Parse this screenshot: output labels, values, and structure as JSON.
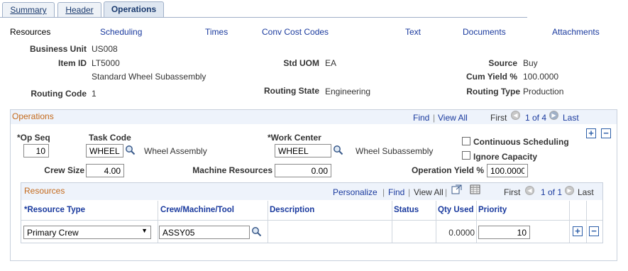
{
  "tabs": [
    {
      "label": "Summary"
    },
    {
      "label": "Header"
    },
    {
      "label": "Operations"
    }
  ],
  "links": {
    "resources": "Resources",
    "scheduling": "Scheduling",
    "times": "Times",
    "conv_cost_codes": "Conv Cost Codes",
    "text": "Text",
    "documents": "Documents",
    "attachments": "Attachments"
  },
  "header": {
    "business_unit_label": "Business Unit",
    "business_unit": "US008",
    "item_id_label": "Item ID",
    "item_id": "LT5000",
    "item_desc": "Standard Wheel Subassembly",
    "routing_code_label": "Routing Code",
    "routing_code": "1",
    "std_uom_label": "Std UOM",
    "std_uom": "EA",
    "routing_state_label": "Routing State",
    "routing_state": "Engineering",
    "source_label": "Source",
    "source": "Buy",
    "cum_yield_label": "Cum Yield %",
    "cum_yield": "100.0000",
    "routing_type_label": "Routing Type",
    "routing_type": "Production"
  },
  "operations": {
    "title": "Operations",
    "find": "Find",
    "view_all": "View All",
    "first": "First",
    "count": "1 of 4",
    "last": "Last",
    "op_seq_label": "*Op Seq",
    "op_seq": "10",
    "task_code_label": "Task Code",
    "task_code": "WHEEL",
    "task_desc": "Wheel Assembly",
    "work_center_label": "*Work Center",
    "work_center": "WHEEL",
    "work_center_desc": "Wheel Subassembly",
    "continuous_scheduling": "Continuous Scheduling",
    "ignore_capacity": "Ignore Capacity",
    "crew_size_label": "Crew Size",
    "crew_size": "4.00",
    "machine_resources_label": "Machine Resources",
    "machine_resources": "0.00",
    "operation_yield_label": "Operation Yield %",
    "operation_yield": "100.0000",
    "add": "+",
    "remove": "−"
  },
  "resources": {
    "title": "Resources",
    "personalize": "Personalize",
    "find": "Find",
    "view_all": "View All",
    "first": "First",
    "count": "1 of 1",
    "last": "Last",
    "columns": [
      "*Resource Type",
      "Crew/Machine/Tool",
      "Description",
      "Status",
      "Qty Used",
      "Priority"
    ],
    "row": {
      "resource_type": "Primary Crew",
      "crew_machine_tool": "ASSY05",
      "description": "",
      "status": "",
      "qty_used": "0.0000",
      "priority": "10"
    },
    "add": "+",
    "remove": "−"
  },
  "icons": {
    "lookup": "magnifier-icon",
    "zoom": "popup-icon",
    "download": "grid-download-icon",
    "prev": "prev-arrow-icon",
    "next": "next-arrow-icon"
  },
  "colors": {
    "link": "#1a3a9e",
    "section_title": "#c46a1c",
    "section_header_bg": "#eef3fb",
    "tab_active_bg": "#dfe7f1"
  }
}
